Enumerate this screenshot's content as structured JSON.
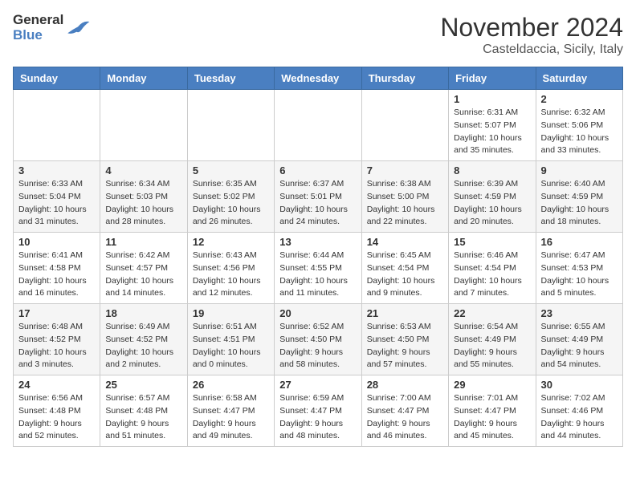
{
  "header": {
    "logo_line1": "General",
    "logo_line2": "Blue",
    "month_title": "November 2024",
    "subtitle": "Casteldaccia, Sicily, Italy"
  },
  "days_of_week": [
    "Sunday",
    "Monday",
    "Tuesday",
    "Wednesday",
    "Thursday",
    "Friday",
    "Saturday"
  ],
  "weeks": [
    [
      {
        "day": "",
        "info": ""
      },
      {
        "day": "",
        "info": ""
      },
      {
        "day": "",
        "info": ""
      },
      {
        "day": "",
        "info": ""
      },
      {
        "day": "",
        "info": ""
      },
      {
        "day": "1",
        "info": "Sunrise: 6:31 AM\nSunset: 5:07 PM\nDaylight: 10 hours and 35 minutes."
      },
      {
        "day": "2",
        "info": "Sunrise: 6:32 AM\nSunset: 5:06 PM\nDaylight: 10 hours and 33 minutes."
      }
    ],
    [
      {
        "day": "3",
        "info": "Sunrise: 6:33 AM\nSunset: 5:04 PM\nDaylight: 10 hours and 31 minutes."
      },
      {
        "day": "4",
        "info": "Sunrise: 6:34 AM\nSunset: 5:03 PM\nDaylight: 10 hours and 28 minutes."
      },
      {
        "day": "5",
        "info": "Sunrise: 6:35 AM\nSunset: 5:02 PM\nDaylight: 10 hours and 26 minutes."
      },
      {
        "day": "6",
        "info": "Sunrise: 6:37 AM\nSunset: 5:01 PM\nDaylight: 10 hours and 24 minutes."
      },
      {
        "day": "7",
        "info": "Sunrise: 6:38 AM\nSunset: 5:00 PM\nDaylight: 10 hours and 22 minutes."
      },
      {
        "day": "8",
        "info": "Sunrise: 6:39 AM\nSunset: 4:59 PM\nDaylight: 10 hours and 20 minutes."
      },
      {
        "day": "9",
        "info": "Sunrise: 6:40 AM\nSunset: 4:59 PM\nDaylight: 10 hours and 18 minutes."
      }
    ],
    [
      {
        "day": "10",
        "info": "Sunrise: 6:41 AM\nSunset: 4:58 PM\nDaylight: 10 hours and 16 minutes."
      },
      {
        "day": "11",
        "info": "Sunrise: 6:42 AM\nSunset: 4:57 PM\nDaylight: 10 hours and 14 minutes."
      },
      {
        "day": "12",
        "info": "Sunrise: 6:43 AM\nSunset: 4:56 PM\nDaylight: 10 hours and 12 minutes."
      },
      {
        "day": "13",
        "info": "Sunrise: 6:44 AM\nSunset: 4:55 PM\nDaylight: 10 hours and 11 minutes."
      },
      {
        "day": "14",
        "info": "Sunrise: 6:45 AM\nSunset: 4:54 PM\nDaylight: 10 hours and 9 minutes."
      },
      {
        "day": "15",
        "info": "Sunrise: 6:46 AM\nSunset: 4:54 PM\nDaylight: 10 hours and 7 minutes."
      },
      {
        "day": "16",
        "info": "Sunrise: 6:47 AM\nSunset: 4:53 PM\nDaylight: 10 hours and 5 minutes."
      }
    ],
    [
      {
        "day": "17",
        "info": "Sunrise: 6:48 AM\nSunset: 4:52 PM\nDaylight: 10 hours and 3 minutes."
      },
      {
        "day": "18",
        "info": "Sunrise: 6:49 AM\nSunset: 4:52 PM\nDaylight: 10 hours and 2 minutes."
      },
      {
        "day": "19",
        "info": "Sunrise: 6:51 AM\nSunset: 4:51 PM\nDaylight: 10 hours and 0 minutes."
      },
      {
        "day": "20",
        "info": "Sunrise: 6:52 AM\nSunset: 4:50 PM\nDaylight: 9 hours and 58 minutes."
      },
      {
        "day": "21",
        "info": "Sunrise: 6:53 AM\nSunset: 4:50 PM\nDaylight: 9 hours and 57 minutes."
      },
      {
        "day": "22",
        "info": "Sunrise: 6:54 AM\nSunset: 4:49 PM\nDaylight: 9 hours and 55 minutes."
      },
      {
        "day": "23",
        "info": "Sunrise: 6:55 AM\nSunset: 4:49 PM\nDaylight: 9 hours and 54 minutes."
      }
    ],
    [
      {
        "day": "24",
        "info": "Sunrise: 6:56 AM\nSunset: 4:48 PM\nDaylight: 9 hours and 52 minutes."
      },
      {
        "day": "25",
        "info": "Sunrise: 6:57 AM\nSunset: 4:48 PM\nDaylight: 9 hours and 51 minutes."
      },
      {
        "day": "26",
        "info": "Sunrise: 6:58 AM\nSunset: 4:47 PM\nDaylight: 9 hours and 49 minutes."
      },
      {
        "day": "27",
        "info": "Sunrise: 6:59 AM\nSunset: 4:47 PM\nDaylight: 9 hours and 48 minutes."
      },
      {
        "day": "28",
        "info": "Sunrise: 7:00 AM\nSunset: 4:47 PM\nDaylight: 9 hours and 46 minutes."
      },
      {
        "day": "29",
        "info": "Sunrise: 7:01 AM\nSunset: 4:47 PM\nDaylight: 9 hours and 45 minutes."
      },
      {
        "day": "30",
        "info": "Sunrise: 7:02 AM\nSunset: 4:46 PM\nDaylight: 9 hours and 44 minutes."
      }
    ]
  ]
}
